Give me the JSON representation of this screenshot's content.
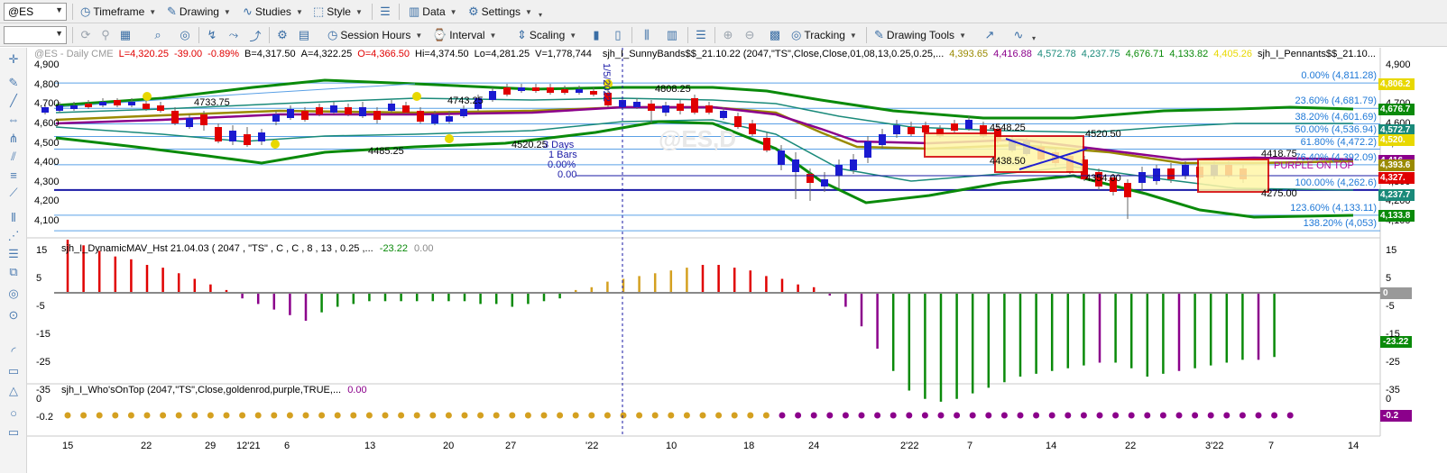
{
  "toolbar1": {
    "symbol": "@ES",
    "timeframe": "Timeframe",
    "drawing": "Drawing",
    "studies": "Studies",
    "style": "Style",
    "data": "Data",
    "settings": "Settings"
  },
  "toolbar2": {
    "session_hours": "Session Hours",
    "interval": "Interval",
    "scaling": "Scaling",
    "tracking": "Tracking",
    "drawing_tools": "Drawing Tools"
  },
  "header": {
    "symbol_info": "@ES - Daily  CME",
    "L": "L=4,320.25",
    "chg": "-39.00",
    "pct": "-0.89%",
    "B": "B=4,317.50",
    "A": "A=4,322.25",
    "O": "O=4,366.50",
    "Hi": "Hi=4,374.50",
    "Lo": "Lo=4,281.25",
    "V": "V=1,778,744",
    "study1": "sjh_I_SunnyBands$$_21.10.22 (2047,\"TS\",Close,Close,01,08,13,0.25,0.25,...",
    "v1": "4,393.65",
    "v2": "4,416.88",
    "v3": "4,572.78",
    "v4": "4,237.75",
    "v5": "4,676.71",
    "v6": "4,133.82",
    "v7": "4,405.26",
    "study2": "sjh_I_Pennants$$_21.10...",
    "colors": {
      "v1": "#9a8a00",
      "v2": "#8b008b",
      "v3": "#1a8a7a",
      "v4": "#1a8a7a",
      "v5": "#0a8a0a",
      "v6": "#0a8a0a",
      "v7": "#e8d800"
    }
  },
  "price_pane": {
    "y_ticks": [
      "4,900",
      "4,800",
      "4,700",
      "4,600",
      "4,500",
      "4,400",
      "4,300",
      "4,200",
      "4,100"
    ],
    "fib_levels": [
      {
        "label": "0.00% (4,811.28)"
      },
      {
        "label": "23.60% (4,681.79)"
      },
      {
        "label": "38.20% (4,601.69)"
      },
      {
        "label": "50.00% (4,536.94)"
      },
      {
        "label": "61.80% (4,472.2)"
      },
      {
        "label": "76.40% (4,392.09)"
      },
      {
        "label": "100.00% (4,262.6)"
      },
      {
        "label": "123.60% (4,133.11)"
      },
      {
        "label": "138.20% (4,053)"
      }
    ],
    "price_badges": [
      {
        "text": "4,806.2",
        "color": "#e8d800"
      },
      {
        "text": "4,676.7",
        "color": "#0a8a0a"
      },
      {
        "text": "4,572.7",
        "color": "#1a8a7a"
      },
      {
        "text": "4,520.",
        "color": "#e8d800"
      },
      {
        "text": "4,416.",
        "color": "#8b008b"
      },
      {
        "text": "4,393.6",
        "color": "#9a8a00"
      },
      {
        "text": "4,327.",
        "color": "#e00000"
      },
      {
        "text": "4,237.7",
        "color": "#1a8a7a"
      },
      {
        "text": "4,133.8",
        "color": "#0a8a0a"
      }
    ],
    "annotations": {
      "a1": "4733.75",
      "a2": "4743.25",
      "a3": "4808.25",
      "a4": "4485.25",
      "a5": "4520.25",
      "a6": "4548.25",
      "a7": "4520.50",
      "a8": "4438.50",
      "a9": "4354.00",
      "a10": "4418.75",
      "a11": "4275.00",
      "purple_on_top": "PURPLE ON TOP",
      "days": "3 Days",
      "bars": "1 Bars",
      "pct": "0.00%",
      "zero": "0.00",
      "vline_date": "1/5/2022"
    }
  },
  "macd_pane": {
    "title": "sjh_I_DynamicMAV_Hst 21.04.03 ( 2047 , \"TS\" , C , C ,  8 , 13 , 0.25 ,...",
    "value1": "-23.22",
    "value2": "0.00",
    "y_ticks": [
      "15",
      "5",
      "-5",
      "-15",
      "-25",
      "-35"
    ],
    "badge_zero": "0",
    "badge_last": "-23.22"
  },
  "who_pane": {
    "title": "sjh_I_Who'sOnTop (2047,\"TS\",Close,goldenrod,purple,TRUE,...",
    "value": "0.00",
    "y_ticks": [
      "0",
      "-0.2"
    ],
    "badge": "-0.2"
  },
  "x_axis": {
    "labels": [
      "15",
      "22",
      "29",
      "12'21",
      "6",
      "13",
      "20",
      "27",
      "'22",
      "10",
      "18",
      "24",
      "2'22",
      "7",
      "14",
      "22",
      "3'22",
      "7",
      "14"
    ]
  },
  "macd_histogram": [
    19,
    17,
    15,
    13,
    12,
    10,
    9,
    7,
    5,
    3,
    1,
    -2,
    -4,
    -6,
    -8,
    -10,
    -7,
    -5,
    -4,
    -3,
    -3,
    -3,
    -3,
    -3,
    -3,
    -3,
    -4,
    -4,
    -5,
    -4,
    -3,
    -2,
    1,
    2,
    4,
    5,
    6,
    7,
    8,
    9,
    10,
    10,
    9,
    8,
    6,
    5,
    3,
    2,
    -1,
    -5,
    -12,
    -20,
    -28,
    -35,
    -38,
    -39,
    -38,
    -36,
    -34,
    -32,
    -30,
    -29,
    -28,
    -27,
    -26,
    -25,
    -25,
    -27,
    -30,
    -29,
    -28,
    -27,
    -26,
    -25,
    -24,
    -24,
    -23
  ]
}
